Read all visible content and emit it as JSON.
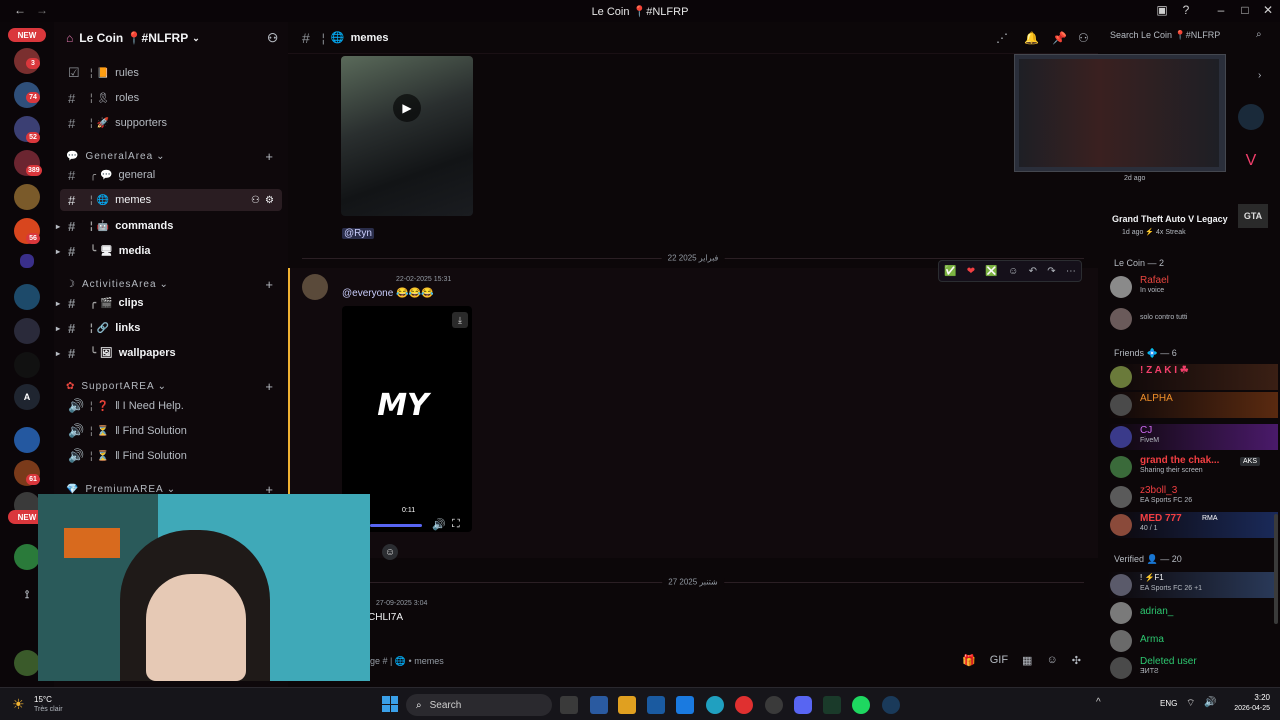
{
  "window": {
    "title": "Le Coin 📍#NLFRP"
  },
  "rail": {
    "new_top": "NEW",
    "new_bottom": "NEW",
    "badges": [
      "3",
      "74",
      "52",
      "389",
      "56",
      "61"
    ]
  },
  "server": {
    "name": "Le Coin 📍#NLFRP"
  },
  "channels": {
    "rules": "rules",
    "roles": "roles",
    "supporters": "supporters",
    "cat_general": "GeneralArea",
    "general": "general",
    "memes": "memes",
    "commands": "commands",
    "media": "media",
    "cat_activities": "ActivitiesArea",
    "clips": "clips",
    "links": "links",
    "wallpapers": "wallpapers",
    "cat_support": "SupportAREA",
    "need_help": "I Need Help.",
    "find_solution_1": "Find Solution",
    "find_solution_2": "Find Solution",
    "cat_premium": "PremiumAREA"
  },
  "chat_header": {
    "channel": "memes"
  },
  "messages": {
    "mention_ryn": "@Ryn",
    "date_divider_1": "22 فبراير 2025",
    "timestamp_1": "22-02-2025 15:31",
    "everyone_text": "@everyone 😂😂😂",
    "video_text": "MY",
    "video_time": "0:11",
    "date_divider_2": "27 شتنبر 2025",
    "timestamp_2": "27-09-2025 3:04",
    "author_2": "CHLI7A",
    "input_placeholder": "ge # | 🌐 • memes"
  },
  "members": {
    "search_placeholder": "Search Le Coin 📍#NLFRP",
    "activity_time": "2d ago",
    "game_title": "Grand Theft Auto V Legacy",
    "game_sub": "1d ago  ⚡ 4x Streak",
    "group_lecoin": "Le Coin — 2",
    "group_friends": "Friends 💠 — 6",
    "group_verified": "Verified 👤 — 20",
    "list": [
      {
        "name": "Rafael",
        "status": "In voice",
        "color": "#e8463f"
      },
      {
        "name": "",
        "status": "solo contro tutti",
        "color": "#f2f3f5"
      },
      {
        "name": "! Z A K I ☘",
        "status": "",
        "color": "#f23f6b"
      },
      {
        "name": "ALPHA",
        "status": "",
        "color": "#f0902a"
      },
      {
        "name": "CJ",
        "status": "FiveM",
        "color": "#d06bf2"
      },
      {
        "name": "grand the chak...",
        "status": "Sharing their screen",
        "color": "#f23f42"
      },
      {
        "name": "z3boll_3",
        "status": "EA Sports FC 26",
        "color": "#f23f42"
      },
      {
        "name": "MED 777",
        "status": "40 / 1",
        "color": "#f23f42"
      },
      {
        "name": "! ⚡F1",
        "status": "EA Sports FC 26 +1",
        "color": "#f2f3f5"
      },
      {
        "name": "adrian_",
        "status": "",
        "color": "#2dc770"
      },
      {
        "name": "Arma",
        "status": "",
        "color": "#2dc770"
      },
      {
        "name": "Deleted user",
        "status": "ƎИTƧ",
        "color": "#2dc770"
      }
    ],
    "tag_aks": "AKS",
    "tag_rma": "RMA"
  },
  "taskbar": {
    "weather_temp": "15°C",
    "weather_desc": "Très clair",
    "search": "Search",
    "lang": "ENG",
    "time": "3:20",
    "date": "2026-04-25"
  }
}
